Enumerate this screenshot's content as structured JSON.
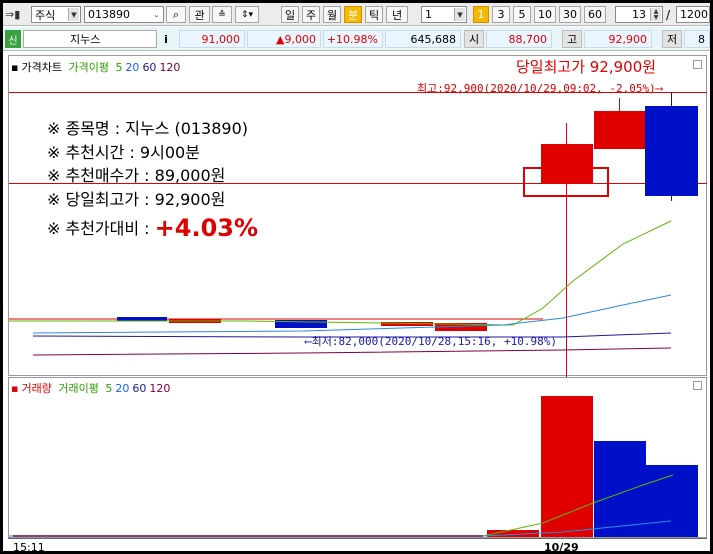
{
  "toolbar": {
    "market": "주식",
    "code": "013890",
    "btn_kwan": "관",
    "periods": [
      "일",
      "주",
      "월",
      "분",
      "틱",
      "년"
    ],
    "active_period": "분",
    "unit_value": "1",
    "active_unit": "1",
    "units": [
      "3",
      "5",
      "10",
      "30",
      "60"
    ],
    "zoom": "13",
    "count": "1200",
    "edge_digit": "8"
  },
  "quote": {
    "badge": "신",
    "name": "지누스",
    "info_btn": "i",
    "price": "91,000",
    "change": "▲9,000",
    "rate": "+10.98%",
    "volume": "645,688",
    "open_label": "시",
    "open": "88,700",
    "high_label": "고",
    "high": "92,900",
    "low_label": "저"
  },
  "price_pane": {
    "title": "가격차트",
    "ma_label": "가격이평",
    "ma_periods": [
      "5",
      "20",
      "60",
      "120"
    ],
    "daily_high_title": "당일최고가 92,900원",
    "high_note": "최고:92,900(2020/10/29,09:02, -2.05%)⟶",
    "low_note": "⟵최저:82,000(2020/10/28,15:16, +10.98%)"
  },
  "volume_pane": {
    "title": "거래량",
    "ma_label": "거래이평",
    "ma_periods": [
      "5",
      "20",
      "60",
      "120"
    ]
  },
  "info_box": {
    "l1": "※ 종목명 : 지누스 (013890)",
    "l2": "※ 추천시간 : 9시00분",
    "l3": "※ 추천매수가 : 89,000원",
    "l4": "※ 당일최고가 : 92,900원",
    "l5_prefix": "※ 추천가대비 :",
    "l5_value": "+4.03%"
  },
  "time_axis": {
    "left": "15:11",
    "right": "10/29"
  },
  "colors": {
    "up": "#e00000",
    "down": "#0010c8",
    "ma5": "#5cb800",
    "ma20": "#2a8ae0",
    "ma60": "#1a1a9a",
    "ma120": "#800040"
  }
}
